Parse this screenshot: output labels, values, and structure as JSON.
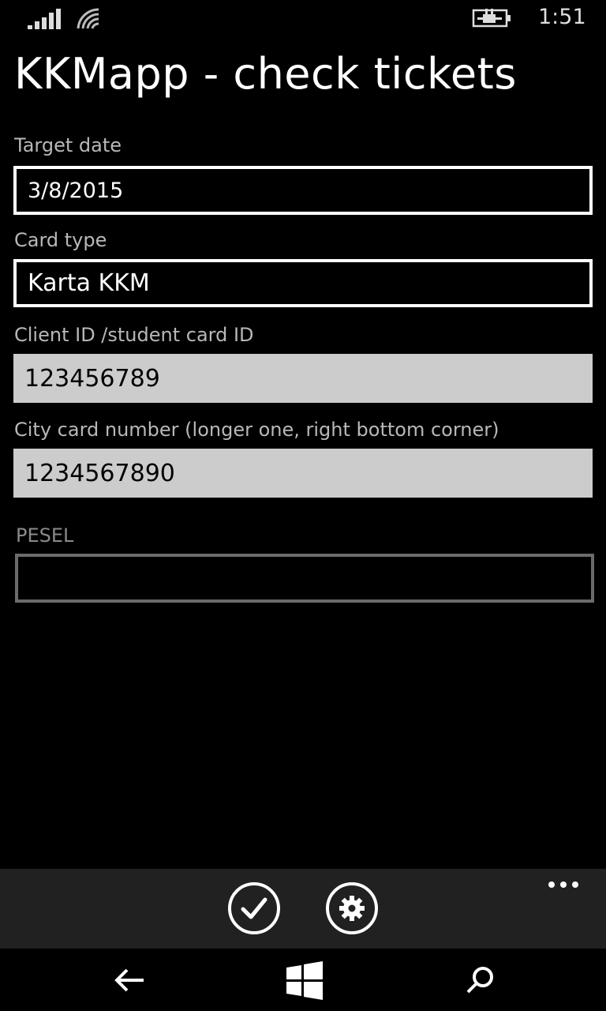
{
  "status_bar": {
    "time": "1:51"
  },
  "header": {
    "title": "KKMapp - check tickets"
  },
  "form": {
    "target_date": {
      "label": "Target date",
      "value": "3/8/2015"
    },
    "card_type": {
      "label": "Card type",
      "value": "Karta KKM"
    },
    "client_id": {
      "label": "Client ID /student card ID",
      "value": "123456789"
    },
    "city_card": {
      "label": "City card number (longer one, right bottom corner)",
      "value": "1234567890"
    },
    "pesel": {
      "label": "PESEL",
      "value": ""
    }
  },
  "app_bar": {
    "buttons": [
      {
        "icon": "check-icon"
      },
      {
        "icon": "gear-icon"
      }
    ],
    "more": "more-icon"
  },
  "nav_bar": {
    "icons": [
      "back-arrow-icon",
      "windows-logo-icon",
      "search-icon"
    ]
  },
  "colors": {
    "background": "#000000",
    "app_bar": "#212121",
    "input_light": "#cccccc",
    "label": "#b8b8b8",
    "disabled_border": "#6b6b6b"
  }
}
